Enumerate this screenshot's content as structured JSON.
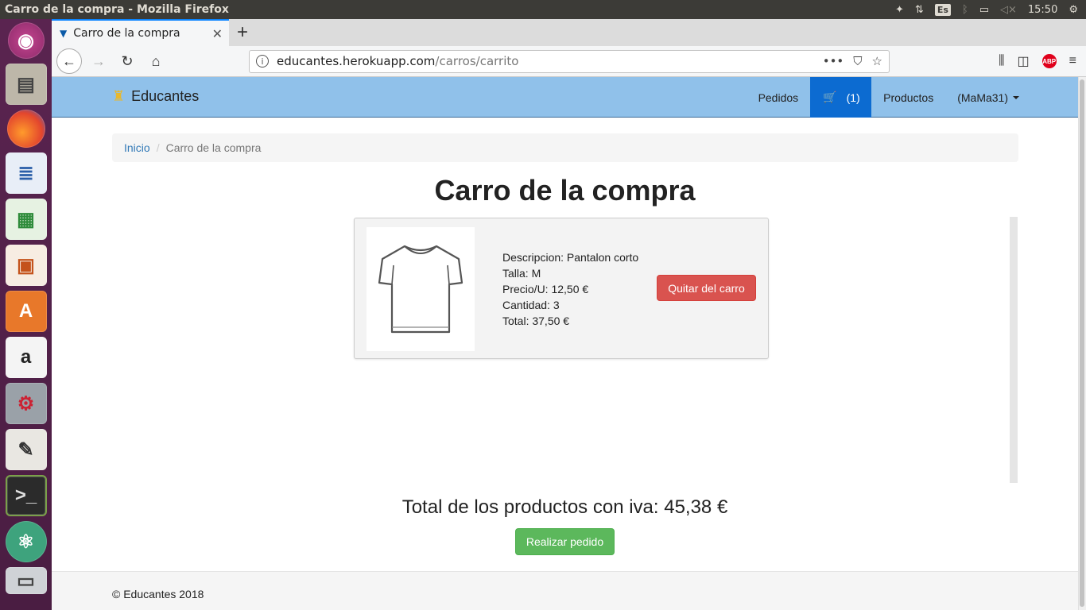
{
  "os": {
    "window_title": "Carro de la compra - Mozilla Firefox",
    "keyboard_lang": "Es",
    "clock": "15:50"
  },
  "browser": {
    "tab_title": "Carro de la compra",
    "url_host": "educantes.herokuapp.com",
    "url_path": "/carros/carrito"
  },
  "site": {
    "brand": "Educantes",
    "nav": {
      "orders": "Pedidos",
      "cart_count": "(1)",
      "products": "Productos",
      "user": "(MaMa31)"
    },
    "breadcrumb": {
      "home": "Inicio",
      "current": "Carro de la compra"
    },
    "page_title": "Carro de la compra",
    "cart_item": {
      "description": "Descripcion: Pantalon corto",
      "size": "Talla: M",
      "unit_price": "Precio/U: 12,50 €",
      "quantity": "Cantidad: 3",
      "total": "Total: 37,50 €",
      "remove_label": "Quitar del carro"
    },
    "total_text": "Total de los productos con iva: 45,38 €",
    "order_button": "Realizar pedido",
    "footer": "© Educantes 2018"
  }
}
